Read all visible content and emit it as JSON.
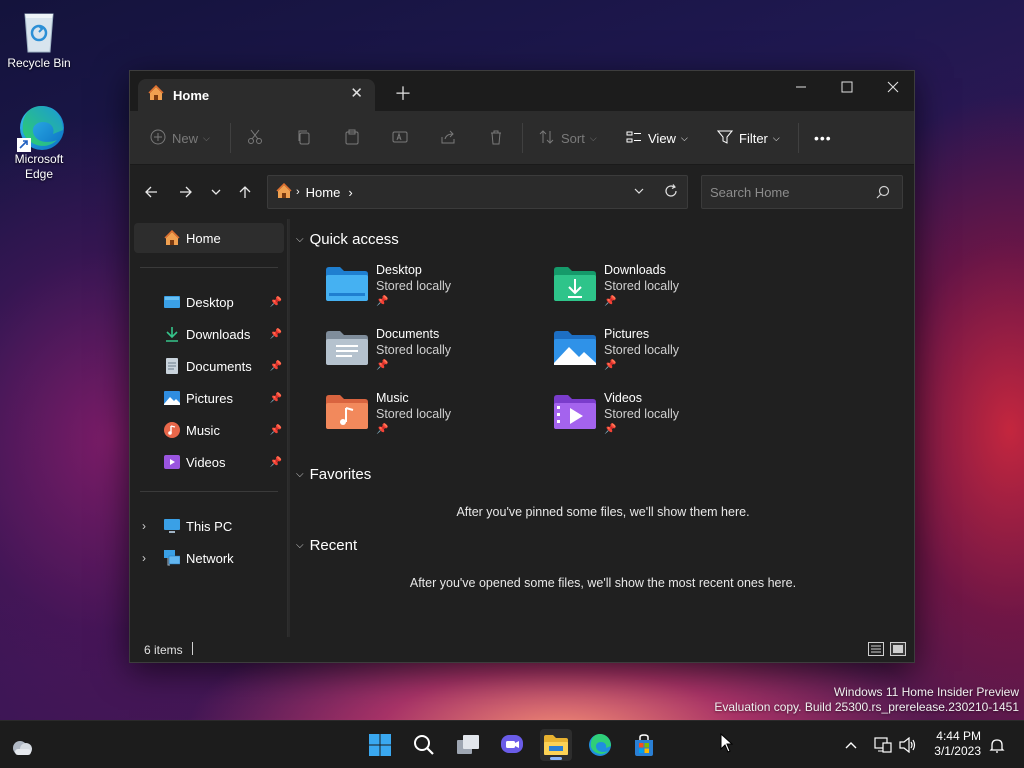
{
  "desktop": {
    "icons": [
      {
        "label": "Recycle Bin"
      },
      {
        "label_line1": "Microsoft",
        "label_line2": "Edge"
      }
    ],
    "watermark": {
      "line1": "Windows 11 Home Insider Preview",
      "line2": "Evaluation copy. Build 25300.rs_prerelease.230210-1451"
    }
  },
  "window": {
    "tab": {
      "title": "Home",
      "close_icon": "close-icon"
    },
    "new_tab_icon": "plus-icon",
    "controls": {
      "minimize": "minimize-icon",
      "maximize": "maximize-icon",
      "close": "close-icon"
    },
    "commandbar": {
      "new_label": "New",
      "sort_label": "Sort",
      "view_label": "View",
      "filter_label": "Filter",
      "more_label": "•••"
    },
    "address": {
      "path": "Home",
      "search_placeholder": "Search Home"
    },
    "sidebar": {
      "items": [
        {
          "label": "Home",
          "icon": "home-icon",
          "selected": true
        },
        {
          "label": "Desktop",
          "icon": "desktop-icon",
          "pinned": true
        },
        {
          "label": "Downloads",
          "icon": "downloads-icon",
          "pinned": true
        },
        {
          "label": "Documents",
          "icon": "documents-icon",
          "pinned": true
        },
        {
          "label": "Pictures",
          "icon": "pictures-icon",
          "pinned": true
        },
        {
          "label": "Music",
          "icon": "music-icon",
          "pinned": true
        },
        {
          "label": "Videos",
          "icon": "videos-icon",
          "pinned": true
        },
        {
          "label": "This PC",
          "icon": "this-pc-icon"
        },
        {
          "label": "Network",
          "icon": "network-icon"
        }
      ]
    },
    "main": {
      "quick_access": {
        "title": "Quick access",
        "items": [
          {
            "name": "Desktop",
            "status": "Stored locally"
          },
          {
            "name": "Downloads",
            "status": "Stored locally"
          },
          {
            "name": "Documents",
            "status": "Stored locally"
          },
          {
            "name": "Pictures",
            "status": "Stored locally"
          },
          {
            "name": "Music",
            "status": "Stored locally"
          },
          {
            "name": "Videos",
            "status": "Stored locally"
          }
        ]
      },
      "favorites": {
        "title": "Favorites",
        "empty_message": "After you've pinned some files, we'll show them here."
      },
      "recent": {
        "title": "Recent",
        "empty_message": "After you've opened some files, we'll show the most recent ones here."
      }
    },
    "statusbar": {
      "item_count": "6 items"
    }
  },
  "taskbar": {
    "apps": [
      "start-icon",
      "search-icon",
      "task-view-icon",
      "chat-icon",
      "file-explorer-icon",
      "edge-icon",
      "store-icon"
    ],
    "clock": {
      "time": "4:44 PM",
      "date": "3/1/2023"
    }
  },
  "colors": {
    "window_bg": "#202020",
    "commandbar_bg": "#2c2c2c",
    "accent": "#8ab4f8"
  }
}
